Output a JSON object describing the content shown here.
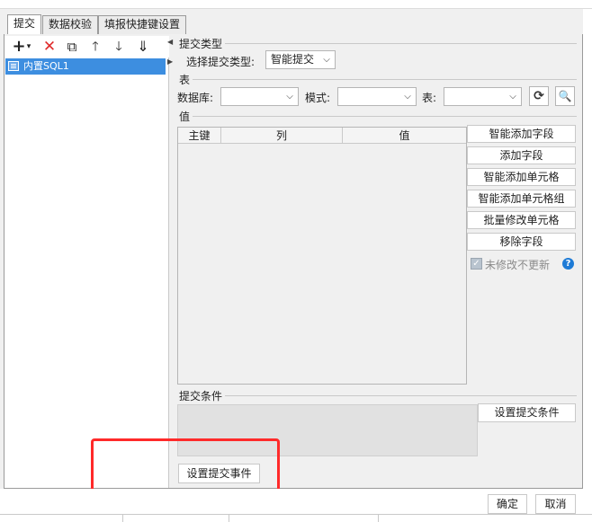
{
  "tabs": [
    "提交",
    "数据校验",
    "填报快捷键设置"
  ],
  "toolbar": {
    "add": "+",
    "add_caret": "▾",
    "delete": "✕",
    "copy": "⧉",
    "up": "🡑",
    "down": "🡓",
    "sort": "⇓"
  },
  "tree": {
    "item": "内置SQL1"
  },
  "submit_type": {
    "section": "提交类型",
    "label": "选择提交类型:",
    "value": "智能提交"
  },
  "table_section": {
    "section": "表",
    "db_label": "数据库:",
    "schema_label": "模式:",
    "table_label": "表:",
    "db_value": "",
    "schema_value": "",
    "table_value": ""
  },
  "value_section": {
    "section": "值",
    "columns": [
      "主键",
      "列",
      "值"
    ]
  },
  "actions": [
    "智能添加字段",
    "添加字段",
    "智能添加单元格",
    "智能添加单元格组",
    "批量修改单元格",
    "移除字段"
  ],
  "checkbox": {
    "label": "未修改不更新",
    "checked": true
  },
  "condition": {
    "section": "提交条件",
    "button": "设置提交条件"
  },
  "event_button": "设置提交事件",
  "dialog": {
    "ok": "确定",
    "cancel": "取消"
  },
  "colors": {
    "selection": "#3d8ee0",
    "highlight": "#ff2a2a",
    "help": "#1e7bd6"
  },
  "icons": {
    "delete": "close-icon",
    "copy": "copy-icon",
    "refresh": "refresh-icon",
    "preview": "preview-icon",
    "help": "help-icon"
  }
}
